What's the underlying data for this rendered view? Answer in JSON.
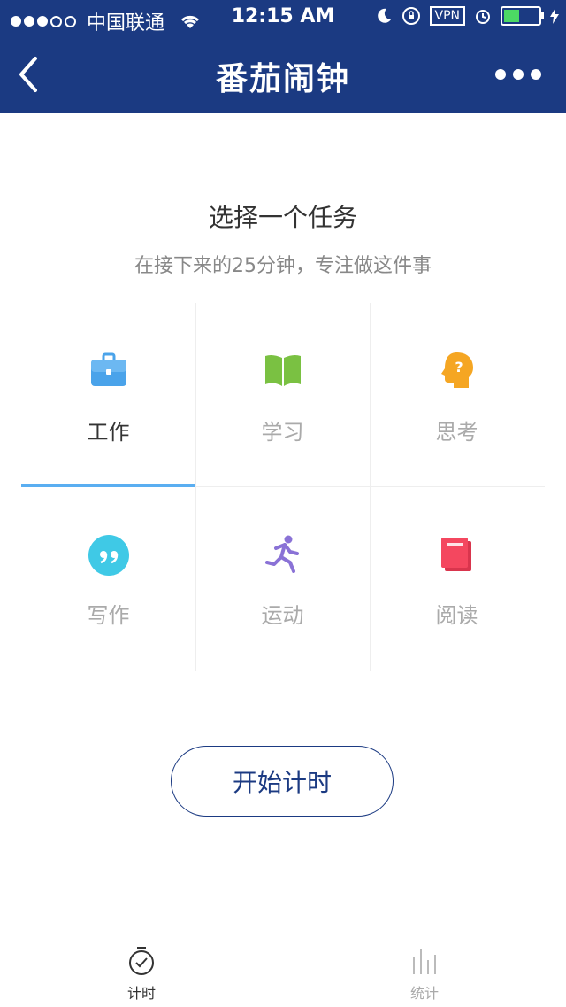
{
  "status_bar": {
    "carrier": "中国联通",
    "time": "12:15 AM",
    "vpn": "VPN",
    "signal_bars_filled": 3,
    "signal_bars_total": 5,
    "battery_level": 0.45
  },
  "nav": {
    "title": "番茄闹钟",
    "back_icon": "chevron-left-icon",
    "more_icon": "more-dots-icon"
  },
  "main": {
    "heading": "选择一个任务",
    "subheading": "在接下来的25分钟，专注做这件事",
    "tasks": [
      {
        "label": "工作",
        "icon": "briefcase-icon",
        "color": "#4aa3ea",
        "selected": true
      },
      {
        "label": "学习",
        "icon": "open-book-icon",
        "color": "#7ac142",
        "selected": false
      },
      {
        "label": "思考",
        "icon": "thinking-head-icon",
        "color": "#f5a623",
        "selected": false
      },
      {
        "label": "写作",
        "icon": "quote-icon",
        "color": "#3fc9e6",
        "selected": false
      },
      {
        "label": "运动",
        "icon": "runner-icon",
        "color": "#8a72d6",
        "selected": false
      },
      {
        "label": "阅读",
        "icon": "closed-book-icon",
        "color": "#f4475f",
        "selected": false
      }
    ],
    "start_button": "开始计时"
  },
  "tabbar": {
    "tabs": [
      {
        "label": "计时",
        "icon": "timer-icon",
        "active": true
      },
      {
        "label": "统计",
        "icon": "stats-icon",
        "active": false
      }
    ]
  },
  "colors": {
    "nav_bg": "#1b3a82",
    "accent_indicator": "#5aaef1",
    "battery_fill": "#4cd964"
  }
}
